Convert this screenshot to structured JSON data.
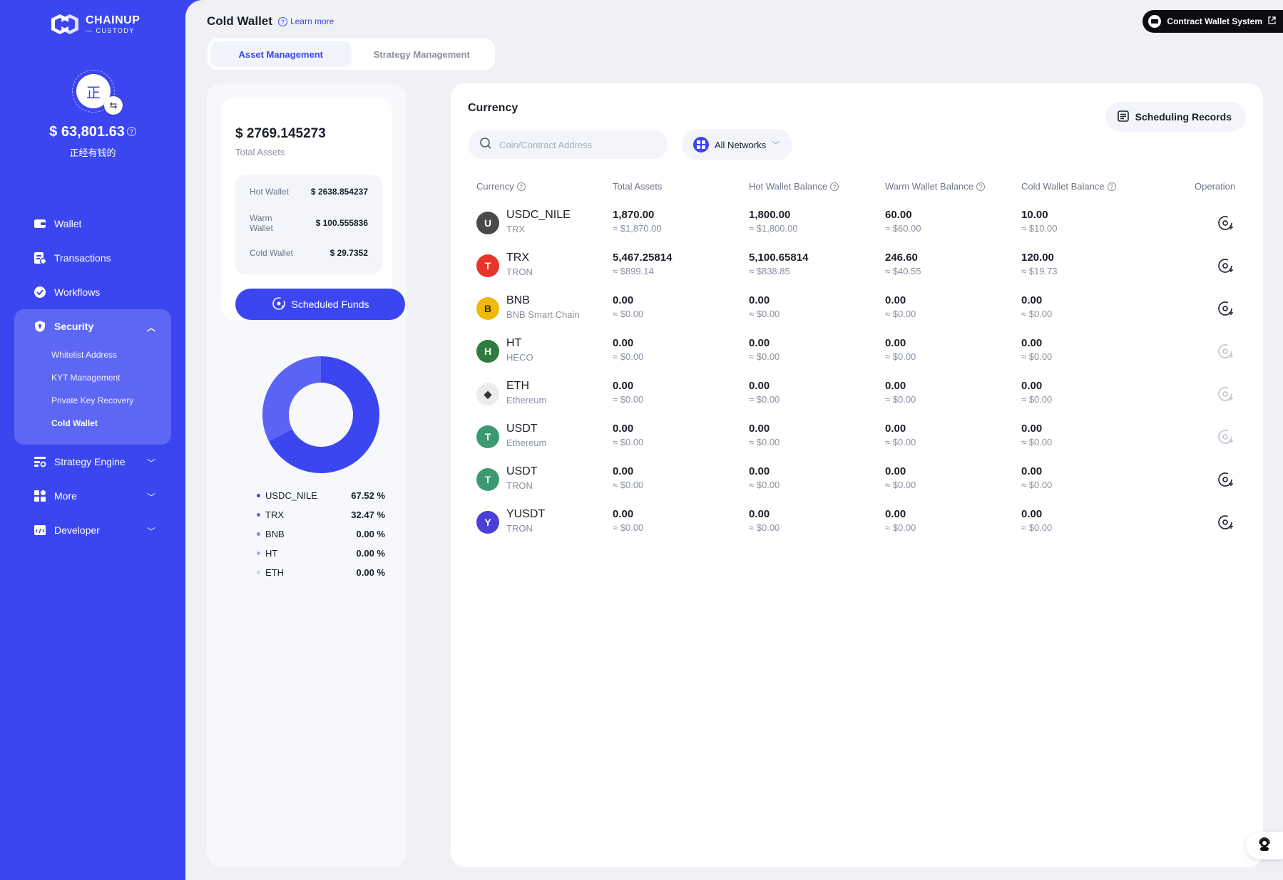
{
  "brand": {
    "name": "CHAINUP",
    "sub": "CUSTODY"
  },
  "user": {
    "avatar_char": "正",
    "balance": "$ 63,801.63",
    "name": "正经有钱的"
  },
  "sidebar": {
    "items": [
      {
        "label": "Wallet",
        "icon": "wallet-icon"
      },
      {
        "label": "Transactions",
        "icon": "transactions-icon"
      },
      {
        "label": "Workflows",
        "icon": "workflows-icon"
      },
      {
        "label": "Security",
        "icon": "shield-icon",
        "expanded": true
      },
      {
        "label": "Strategy Engine",
        "icon": "strategy-icon"
      },
      {
        "label": "More",
        "icon": "grid-icon"
      },
      {
        "label": "Developer",
        "icon": "developer-icon"
      }
    ],
    "security_sub": [
      "Whitelist Address",
      "KYT Management",
      "Private Key Recovery",
      "Cold Wallet"
    ],
    "active_sub": "Cold Wallet"
  },
  "header": {
    "title": "Cold Wallet",
    "learn_more": "Learn more",
    "contract_button": "Contract Wallet System"
  },
  "tabs": [
    {
      "label": "Asset Management",
      "active": true
    },
    {
      "label": "Strategy Management",
      "active": false
    }
  ],
  "summary": {
    "total": "$ 2769.145273",
    "total_label": "Total Assets",
    "breakdown": [
      {
        "label": "Hot Wallet",
        "value": "$ 2638.854237"
      },
      {
        "label": "Warm Wallet",
        "value": "$ 100.555836"
      },
      {
        "label": "Cold Wallet",
        "value": "$ 29.7352"
      }
    ],
    "scheduled_button": "Scheduled Funds"
  },
  "distribution": [
    {
      "name": "USDC_NILE",
      "pct_label": "67.52 %",
      "pct": 67.52,
      "color": "#3b46f1"
    },
    {
      "name": "TRX",
      "pct_label": "32.47 %",
      "pct": 32.47,
      "color": "#5a63f4"
    },
    {
      "name": "BNB",
      "pct_label": "0.00 %",
      "pct": 0,
      "color": "#7d84f6"
    },
    {
      "name": "HT",
      "pct_label": "0.00 %",
      "pct": 0,
      "color": "#a2a7f9"
    },
    {
      "name": "ETH",
      "pct_label": "0.00 %",
      "pct": 0,
      "color": "#c8cbfb"
    }
  ],
  "currency": {
    "title": "Currency",
    "scheduling_records": "Scheduling Records",
    "search_placeholder": "Coin/Contract Address",
    "network_filter": "All Networks",
    "columns": [
      "Currency",
      "Total Assets",
      "Hot Wallet Balance",
      "Warm Wallet Balance",
      "Cold Wallet Balance",
      "Operation"
    ],
    "rows": [
      {
        "symbol": "USDC_NILE",
        "network": "TRX",
        "logo_char": "U",
        "logo_color": "#4a4a4a",
        "total": "1,870.00",
        "total_usd": "≈ $1,870.00",
        "hot": "1,800.00",
        "hot_usd": "≈ $1,800.00",
        "warm": "60.00",
        "warm_usd": "≈ $60.00",
        "cold": "10.00",
        "cold_usd": "≈ $10.00",
        "op_enabled": true
      },
      {
        "symbol": "TRX",
        "network": "TRON",
        "logo_char": "T",
        "logo_color": "#e8352b",
        "total": "5,467.25814",
        "total_usd": "≈ $899.14",
        "hot": "5,100.65814",
        "hot_usd": "≈ $838.85",
        "warm": "246.60",
        "warm_usd": "≈ $40.55",
        "cold": "120.00",
        "cold_usd": "≈ $19.73",
        "op_enabled": true
      },
      {
        "symbol": "BNB",
        "network": "BNB Smart Chain",
        "logo_char": "B",
        "logo_color": "#f0b90b",
        "total": "0.00",
        "total_usd": "≈ $0.00",
        "hot": "0.00",
        "hot_usd": "≈ $0.00",
        "warm": "0.00",
        "warm_usd": "≈ $0.00",
        "cold": "0.00",
        "cold_usd": "≈ $0.00",
        "op_enabled": true
      },
      {
        "symbol": "HT",
        "network": "HECO",
        "logo_char": "H",
        "logo_color": "#2f7a3e",
        "total": "0.00",
        "total_usd": "≈ $0.00",
        "hot": "0.00",
        "hot_usd": "≈ $0.00",
        "warm": "0.00",
        "warm_usd": "≈ $0.00",
        "cold": "0.00",
        "cold_usd": "≈ $0.00",
        "op_enabled": false
      },
      {
        "symbol": "ETH",
        "network": "Ethereum",
        "logo_char": "◆",
        "logo_color": "#ececec",
        "total": "0.00",
        "total_usd": "≈ $0.00",
        "hot": "0.00",
        "hot_usd": "≈ $0.00",
        "warm": "0.00",
        "warm_usd": "≈ $0.00",
        "cold": "0.00",
        "cold_usd": "≈ $0.00",
        "op_enabled": false
      },
      {
        "symbol": "USDT",
        "network": "Ethereum",
        "logo_char": "T",
        "logo_color": "#3c9a73",
        "total": "0.00",
        "total_usd": "≈ $0.00",
        "hot": "0.00",
        "hot_usd": "≈ $0.00",
        "warm": "0.00",
        "warm_usd": "≈ $0.00",
        "cold": "0.00",
        "cold_usd": "≈ $0.00",
        "op_enabled": false
      },
      {
        "symbol": "USDT",
        "network": "TRON",
        "logo_char": "T",
        "logo_color": "#3c9a73",
        "total": "0.00",
        "total_usd": "≈ $0.00",
        "hot": "0.00",
        "hot_usd": "≈ $0.00",
        "warm": "0.00",
        "warm_usd": "≈ $0.00",
        "cold": "0.00",
        "cold_usd": "≈ $0.00",
        "op_enabled": true
      },
      {
        "symbol": "YUSDT",
        "network": "TRON",
        "logo_char": "Y",
        "logo_color": "#4b3fd8",
        "total": "0.00",
        "total_usd": "≈ $0.00",
        "hot": "0.00",
        "hot_usd": "≈ $0.00",
        "warm": "0.00",
        "warm_usd": "≈ $0.00",
        "cold": "0.00",
        "cold_usd": "≈ $0.00",
        "op_enabled": true
      }
    ]
  }
}
